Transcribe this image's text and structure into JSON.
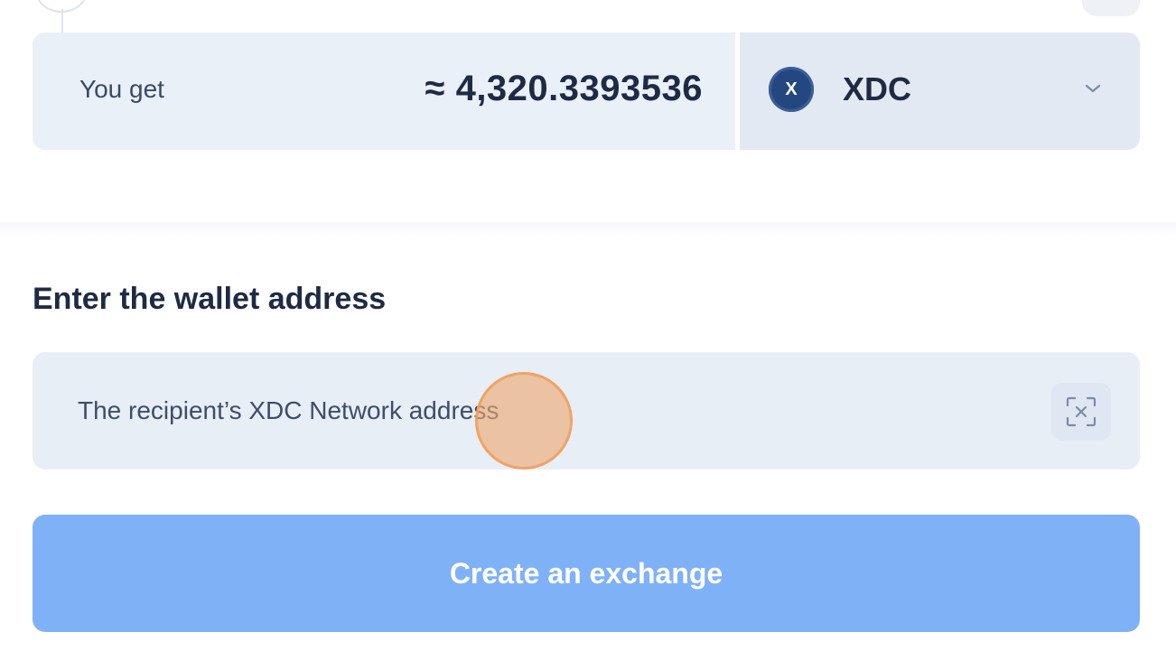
{
  "receive": {
    "label": "You get",
    "amount": "≈ 4,320.3393536",
    "currency": {
      "name": "XDC",
      "icon": "xdc-coin-icon",
      "icon_glyph": "X",
      "color": "#24477f"
    },
    "dropdown_icon": "chevron-down-icon"
  },
  "wallet": {
    "title": "Enter the wallet address",
    "placeholder": "The recipient’s XDC Network address",
    "value": "",
    "scan_icon": "qr-scan-icon"
  },
  "submit": {
    "label": "Create an exchange",
    "color": "#7fb1f7"
  },
  "colors": {
    "text": "#1f2a44",
    "field_bg": "#e8eef6",
    "tap_indicator": "#eea76e"
  }
}
